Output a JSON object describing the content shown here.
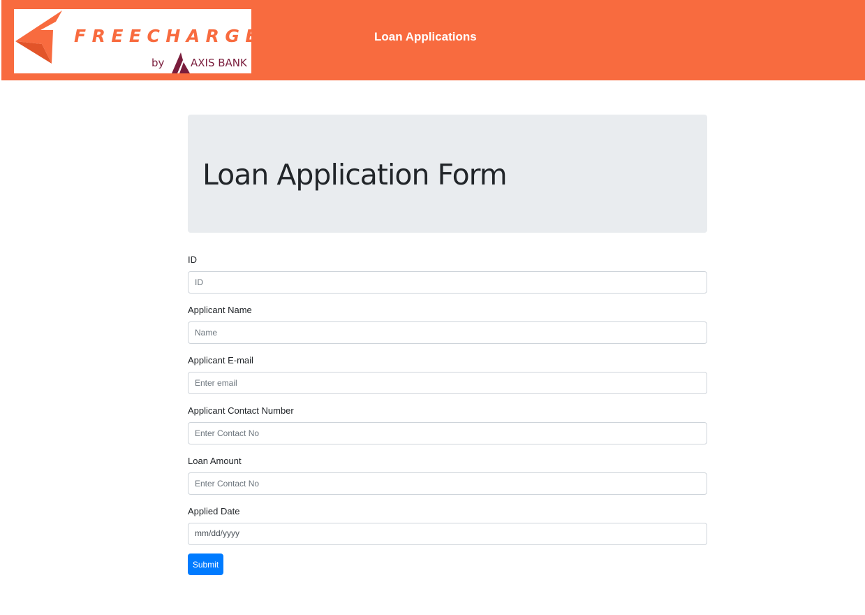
{
  "header": {
    "logo": {
      "brand_text": "FREECHARGE",
      "by_text": "by",
      "partner_text": "AXIS BANK"
    },
    "nav_title": "Loan Applications"
  },
  "page": {
    "title": "Loan Application Form"
  },
  "form": {
    "fields": [
      {
        "label": "ID",
        "placeholder": "ID",
        "value": ""
      },
      {
        "label": "Applicant Name",
        "placeholder": "Name",
        "value": ""
      },
      {
        "label": "Applicant E-mail",
        "placeholder": "Enter email",
        "value": ""
      },
      {
        "label": "Applicant Contact Number",
        "placeholder": "Enter Contact No",
        "value": ""
      },
      {
        "label": "Loan Amount",
        "placeholder": "Enter Contact No",
        "value": ""
      },
      {
        "label": "Applied Date",
        "placeholder": "mm/dd/yyyy",
        "value": ""
      }
    ],
    "submit_label": "Submit"
  },
  "colors": {
    "header_bg": "#f86b3f",
    "jumbotron_bg": "#e9ecef",
    "primary": "#007bff",
    "axis_brand": "#7a1d3c"
  }
}
